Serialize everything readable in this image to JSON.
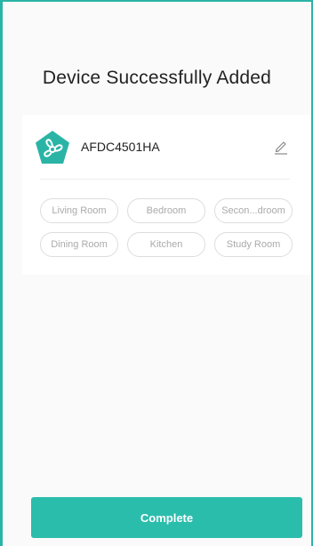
{
  "header": {
    "title": "Device Successfully Added"
  },
  "device": {
    "name": "AFDC4501HA",
    "icon": "fan-icon",
    "icon_color": "#2ab4a6",
    "edit_icon": "pencil-icon"
  },
  "rooms": [
    {
      "label": "Living Room"
    },
    {
      "label": "Bedroom"
    },
    {
      "label": "Secon...droom"
    },
    {
      "label": "Dining Room"
    },
    {
      "label": "Kitchen"
    },
    {
      "label": "Study Room"
    }
  ],
  "footer": {
    "complete_label": "Complete",
    "button_color": "#2bbdac"
  }
}
